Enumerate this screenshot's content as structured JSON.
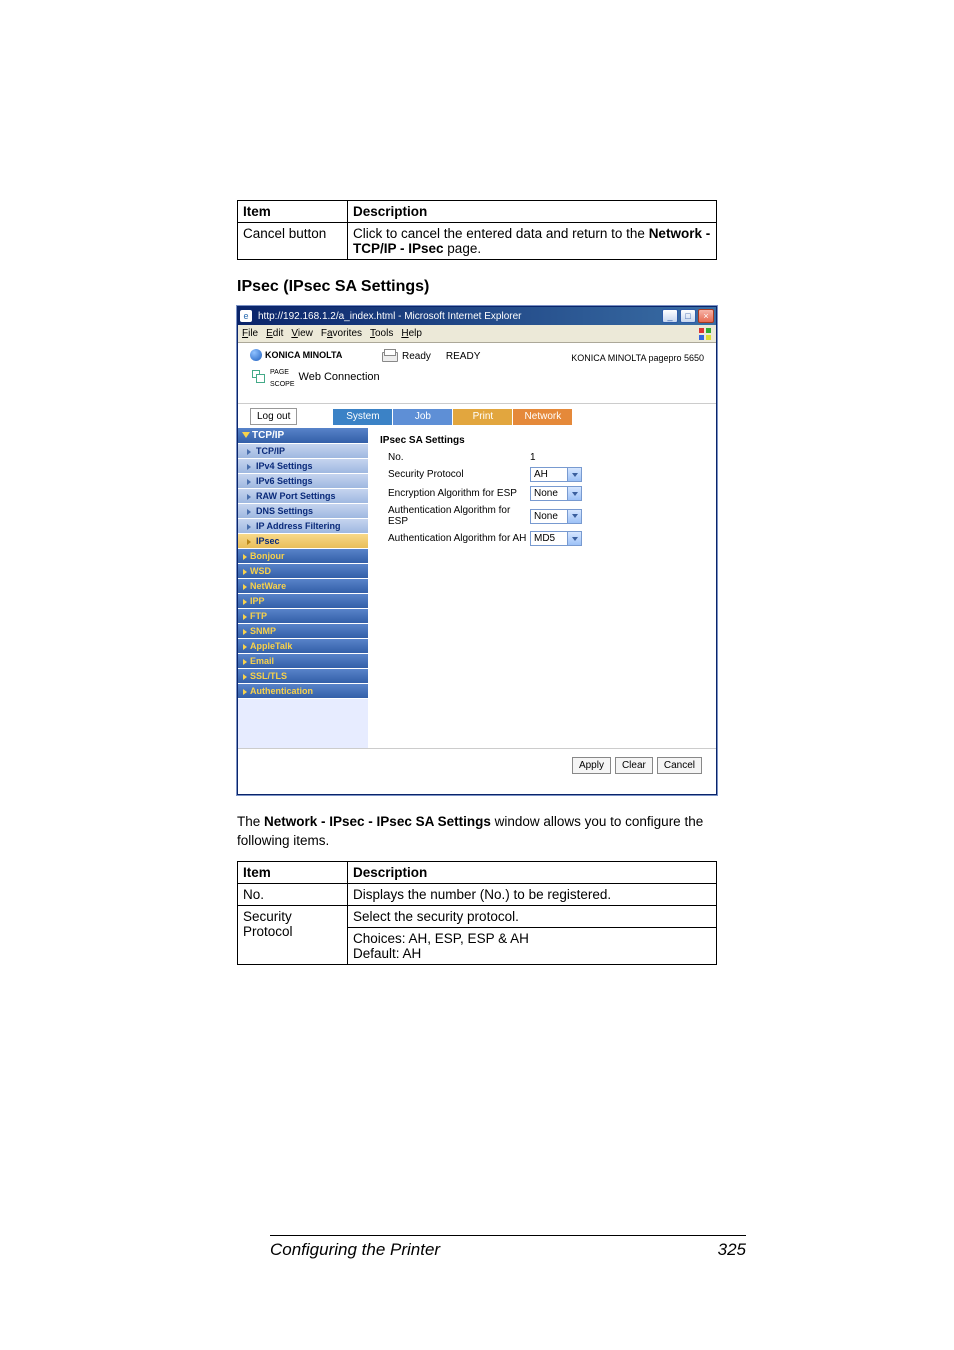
{
  "table1": {
    "headers": [
      "Item",
      "Description"
    ],
    "rows": [
      {
        "item": "Cancel button",
        "desc_line1": "Click to cancel the entered data and return to the ",
        "desc_bold": "Network - TCP/IP - IPsec",
        "desc_tail": " page."
      }
    ]
  },
  "section_title": "IPsec (IPsec SA Settings)",
  "ie": {
    "title": "http://192.168.1.2/a_index.html - Microsoft Internet Explorer",
    "menus": [
      "File",
      "Edit",
      "View",
      "Favorites",
      "Tools",
      "Help"
    ],
    "brand": "KONICA MINOLTA",
    "pagescope": "Web Connection",
    "ready_label": "Ready",
    "ready_status": "READY",
    "model": "KONICA MINOLTA pagepro 5650",
    "logout": "Log out",
    "tabs": [
      "System",
      "Job",
      "Print",
      "Network"
    ],
    "sidebar_top": "TCP/IP",
    "sidebar_sub": [
      "TCP/IP",
      "IPv4 Settings",
      "IPv6 Settings",
      "RAW Port Settings",
      "DNS Settings",
      "IP Address Filtering",
      "IPsec"
    ],
    "sidebar_rest": [
      "Bonjour",
      "WSD",
      "NetWare",
      "IPP",
      "FTP",
      "SNMP",
      "AppleTalk",
      "Email",
      "SSL/TLS",
      "Authentication"
    ],
    "detail_title": "IPsec SA Settings",
    "form": [
      {
        "label": "No.",
        "value": "1",
        "type": "text"
      },
      {
        "label": "Security Protocol",
        "value": "AH",
        "type": "select"
      },
      {
        "label": "Encryption Algorithm for ESP",
        "value": "None",
        "type": "select"
      },
      {
        "label": "Authentication Algorithm for ESP",
        "value": "None",
        "type": "select"
      },
      {
        "label": "Authentication Algorithm for AH",
        "value": "MD5",
        "type": "select"
      }
    ],
    "buttons": [
      "Apply",
      "Clear",
      "Cancel"
    ]
  },
  "caption_pre": "The ",
  "caption_bold": "Network - IPsec - IPsec SA Settings",
  "caption_post": " window allows you to configure the following items.",
  "table2": {
    "headers": [
      "Item",
      "Description"
    ],
    "rows": [
      {
        "item": "No.",
        "desc": "Displays the number (No.) to be registered."
      },
      {
        "item": "Security Protocol",
        "desc": "Select the security protocol.",
        "extra1": "Choices: AH, ESP, ESP & AH",
        "extra2": "Default:  AH"
      }
    ]
  },
  "footer": {
    "title": "Configuring the Printer",
    "page": "325"
  }
}
